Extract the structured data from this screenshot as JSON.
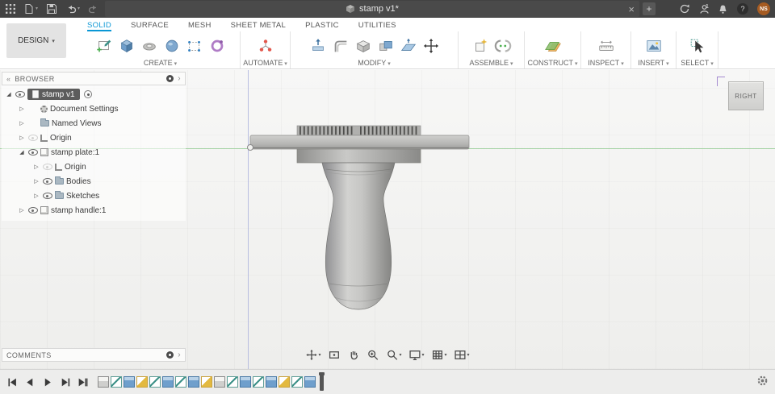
{
  "titlebar": {
    "title": "stamp v1*",
    "profile_badge": "1",
    "help_glyph": "?",
    "user_initials": "NS"
  },
  "ribbon": {
    "design_label": "DESIGN",
    "tabs": [
      {
        "label": "SOLID",
        "active": true
      },
      {
        "label": "SURFACE",
        "active": false
      },
      {
        "label": "MESH",
        "active": false
      },
      {
        "label": "SHEET METAL",
        "active": false
      },
      {
        "label": "PLASTIC",
        "active": false
      },
      {
        "label": "UTILITIES",
        "active": false
      }
    ],
    "groups": [
      {
        "label": "CREATE"
      },
      {
        "label": "AUTOMATE"
      },
      {
        "label": "MODIFY"
      },
      {
        "label": "ASSEMBLE"
      },
      {
        "label": "CONSTRUCT"
      },
      {
        "label": "INSPECT"
      },
      {
        "label": "INSERT"
      },
      {
        "label": "SELECT"
      }
    ]
  },
  "browser": {
    "header": "BROWSER",
    "tree": [
      {
        "label": "stamp v1",
        "exp": "open",
        "eye": "on",
        "icon": "document"
      },
      {
        "label": "Document Settings",
        "exp": "closed",
        "eye": "none",
        "icon": "gear"
      },
      {
        "label": "Named Views",
        "exp": "closed",
        "eye": "none",
        "icon": "folder"
      },
      {
        "label": "Origin",
        "exp": "closed",
        "eye": "off",
        "icon": "origin"
      },
      {
        "label": "stamp plate:1",
        "exp": "open",
        "eye": "on",
        "icon": "component"
      },
      {
        "label": "Origin",
        "exp": "closed",
        "eye": "off",
        "icon": "origin"
      },
      {
        "label": "Bodies",
        "exp": "closed",
        "eye": "on",
        "icon": "folder"
      },
      {
        "label": "Sketches",
        "exp": "closed",
        "eye": "on",
        "icon": "folder"
      },
      {
        "label": "stamp handle:1",
        "exp": "closed",
        "eye": "on",
        "icon": "component"
      }
    ]
  },
  "comments": {
    "header": "COMMENTS"
  },
  "canvas": {
    "viewcube_face": "RIGHT"
  },
  "timeline": {
    "features": [
      {
        "icon": "component"
      },
      {
        "icon": "sketch"
      },
      {
        "icon": "extrude"
      },
      {
        "icon": "fillet"
      },
      {
        "icon": "sketch"
      },
      {
        "icon": "extrude"
      },
      {
        "icon": "sketch"
      },
      {
        "icon": "extrude"
      },
      {
        "icon": "fillet"
      },
      {
        "icon": "component"
      },
      {
        "icon": "sketch"
      },
      {
        "icon": "extrude"
      },
      {
        "icon": "sketch"
      },
      {
        "icon": "extrude"
      },
      {
        "icon": "fillet"
      },
      {
        "icon": "sketch"
      },
      {
        "icon": "extrude"
      }
    ]
  }
}
